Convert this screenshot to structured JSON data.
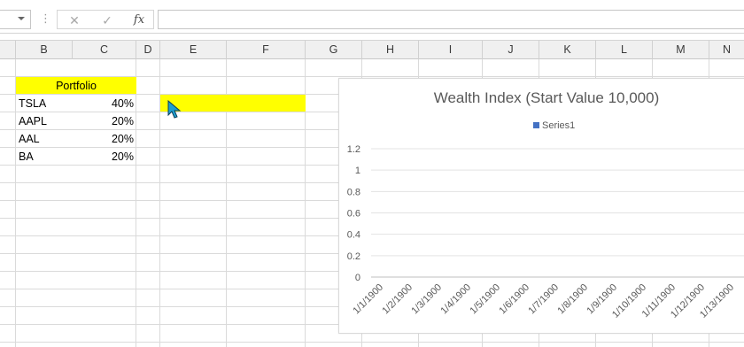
{
  "formula_bar": {
    "cancel_glyph": "✕",
    "enter_glyph": "✓",
    "fx_glyph": "fx",
    "formula": ""
  },
  "columns": [
    "B",
    "C",
    "D",
    "E",
    "F",
    "G",
    "H",
    "I",
    "J",
    "K",
    "L",
    "M",
    "N"
  ],
  "portfolio": {
    "header": "Portfolio",
    "rows": [
      {
        "ticker": "TSLA",
        "weight": "40%"
      },
      {
        "ticker": "AAPL",
        "weight": "20%"
      },
      {
        "ticker": "AAL",
        "weight": "20%"
      },
      {
        "ticker": "BA",
        "weight": "20%"
      }
    ]
  },
  "colors": {
    "highlight": "#ffff00",
    "series": "#4472c4",
    "cursor": "#1e9fd0"
  },
  "chart_data": {
    "type": "bar",
    "title": "Wealth Index (Start Value 10,000)",
    "series": [
      {
        "name": "Series1",
        "values": []
      }
    ],
    "categories": [
      "1/1/1900",
      "1/2/1900",
      "1/3/1900",
      "1/4/1900",
      "1/5/1900",
      "1/6/1900",
      "1/7/1900",
      "1/8/1900",
      "1/9/1900",
      "1/10/1900",
      "1/11/1900",
      "1/12/1900",
      "1/13/1900"
    ],
    "yticks": [
      "1.2",
      "1",
      "0.8",
      "0.6",
      "0.4",
      "0.2",
      "0"
    ],
    "ylim": [
      0,
      1.2
    ],
    "grid": true,
    "legend": "top"
  }
}
